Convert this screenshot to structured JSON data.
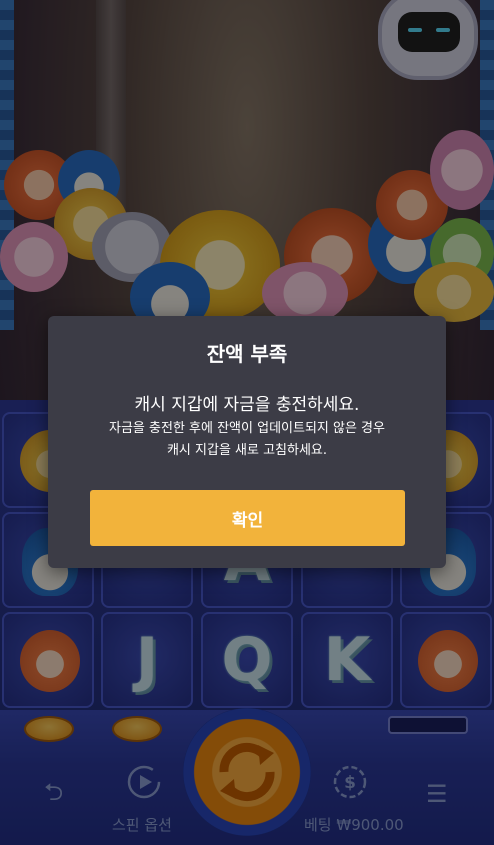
{
  "dialog": {
    "title": "잔액 부족",
    "message": "캐시 지갑에 자금을 충전하세요.",
    "sub_line1": "자금을 충전한 후에 잔액이 업데이트되지 않은 경우",
    "sub_line2": "캐시 지갑을 새로 고침하세요.",
    "confirm_label": "확인"
  },
  "reels": {
    "symbols": [
      "lion",
      "penguin",
      "tiger",
      "penguin",
      "lion",
      "A",
      "tiger",
      "J",
      "Q",
      "K",
      "tiger"
    ]
  },
  "bottom_bar": {
    "back_icon": "back-arrow-icon",
    "spin_options_icon": "play-circle-icon",
    "spin_options_label": "스핀 옵션",
    "spin_icon": "spin-arrows-icon",
    "bet_icon": "dollar-coin-icon",
    "bet_label": "베팅 ₩900.00",
    "menu_icon": "hamburger-menu-icon"
  },
  "colors": {
    "dialog_bg": "#3c3c46",
    "confirm_bg": "#f2b33b",
    "bar_text": "#8ea0d8"
  }
}
